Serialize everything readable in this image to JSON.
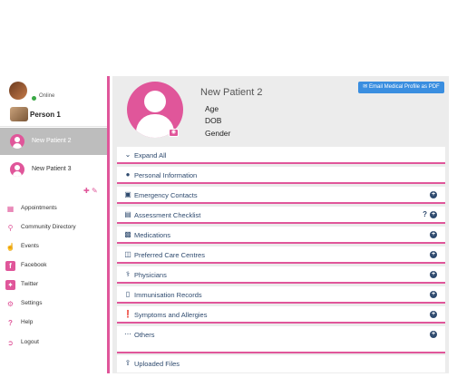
{
  "sidebar": {
    "status": "Online",
    "person": "Person 1",
    "patients": [
      "New Patient 2",
      "New Patient 3"
    ],
    "nav": [
      {
        "label": "Appointments",
        "icon": "calendar-icon"
      },
      {
        "label": "Community Directory",
        "icon": "search-icon"
      },
      {
        "label": "Events",
        "icon": "hand-icon"
      },
      {
        "label": "Facebook",
        "icon": "facebook-icon"
      },
      {
        "label": "Twitter",
        "icon": "twitter-icon"
      },
      {
        "label": "Settings",
        "icon": "gear-icon"
      },
      {
        "label": "Help",
        "icon": "question-icon"
      },
      {
        "label": "Logout",
        "icon": "logout-icon"
      }
    ]
  },
  "profile": {
    "name": "New Patient 2",
    "age_label": "Age",
    "dob_label": "DOB",
    "gender_label": "Gender",
    "email_button": "Email Medical Profile as PDF"
  },
  "sections": {
    "expand_all": "Expand All",
    "items": [
      {
        "label": "Personal Information",
        "icon": "user-icon",
        "plus": false
      },
      {
        "label": "Emergency Contacts",
        "icon": "ambulance-icon",
        "plus": true
      },
      {
        "label": "Assessment Checklist",
        "icon": "list-icon",
        "plus": true,
        "help": "?"
      },
      {
        "label": "Medications",
        "icon": "medkit-icon",
        "plus": true
      },
      {
        "label": "Preferred Care Centres",
        "icon": "hospital-icon",
        "plus": true
      },
      {
        "label": "Physicians",
        "icon": "doctor-icon",
        "plus": true
      },
      {
        "label": "Immunisation Records",
        "icon": "book-icon",
        "plus": true
      },
      {
        "label": "Symptoms and Allergies",
        "icon": "alert-icon",
        "plus": true
      },
      {
        "label": "Others",
        "icon": "more-icon",
        "plus": true
      },
      {
        "label": "Uploaded Files",
        "icon": "upload-icon",
        "plus": false
      }
    ]
  }
}
